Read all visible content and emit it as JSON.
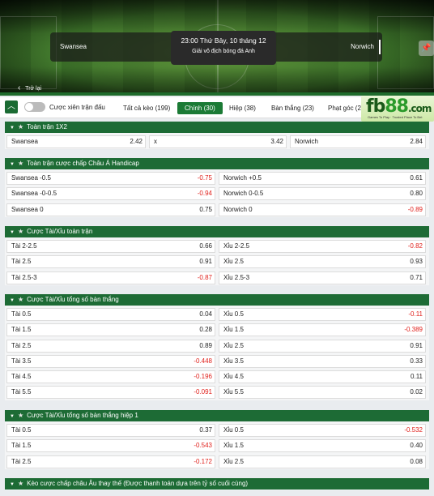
{
  "match": {
    "home": "Swansea",
    "away": "Norwich",
    "time": "23:00 Thứ Bảy, 10 tháng 12",
    "league": "Giải vô địch bóng đá Anh",
    "back_label": "Trở lại"
  },
  "logo": {
    "brand_a": "fb",
    "brand_b": "88",
    "brand_c": ".com",
    "tagline": "Games To Play · Trusted Place To Bet"
  },
  "toolbar": {
    "parlay_label": "Cược xiên trận đấu",
    "tabs": [
      {
        "label": "Tất cả kèo (199)"
      },
      {
        "label": "Chính (30)"
      },
      {
        "label": "Hiệp (38)"
      },
      {
        "label": "Bàn thắng (23)"
      },
      {
        "label": "Phạt góc (24"
      }
    ]
  },
  "sections": [
    {
      "title": "Toàn trận 1X2",
      "rows": [
        {
          "a_label": "Swansea",
          "a_odd": "2.42",
          "b_label": "x",
          "b_odd": "3.42",
          "c_label": "Norwich",
          "c_odd": "2.84"
        }
      ]
    },
    {
      "title": "Toàn trận cược chấp Châu Á Handicap",
      "rows": [
        {
          "l_label": "Swansea -0.5",
          "l_odd": "-0.75",
          "r_label": "Norwich +0.5",
          "r_odd": "0.61"
        },
        {
          "l_label": "Swansea -0-0.5",
          "l_odd": "-0.94",
          "r_label": "Norwich 0-0.5",
          "r_odd": "0.80"
        },
        {
          "l_label": "Swansea 0",
          "l_odd": "0.75",
          "r_label": "Norwich 0",
          "r_odd": "-0.89"
        }
      ]
    },
    {
      "title": "Cược Tài/Xỉu toàn trận",
      "rows": [
        {
          "l_label": "Tài 2-2.5",
          "l_odd": "0.66",
          "r_label": "Xỉu 2-2.5",
          "r_odd": "-0.82"
        },
        {
          "l_label": "Tài 2.5",
          "l_odd": "0.91",
          "r_label": "Xỉu 2.5",
          "r_odd": "0.93"
        },
        {
          "l_label": "Tài 2.5-3",
          "l_odd": "-0.87",
          "r_label": "Xỉu 2.5-3",
          "r_odd": "0.71"
        }
      ]
    },
    {
      "title": "Cược Tài/Xỉu tổng số bàn thắng",
      "rows": [
        {
          "l_label": "Tài 0.5",
          "l_odd": "0.04",
          "r_label": "Xỉu 0.5",
          "r_odd": "-0.11"
        },
        {
          "l_label": "Tài 1.5",
          "l_odd": "0.28",
          "r_label": "Xỉu 1.5",
          "r_odd": "-0.389"
        },
        {
          "l_label": "Tài 2.5",
          "l_odd": "0.89",
          "r_label": "Xỉu 2.5",
          "r_odd": "0.91"
        },
        {
          "l_label": "Tài 3.5",
          "l_odd": "-0.448",
          "r_label": "Xỉu 3.5",
          "r_odd": "0.33"
        },
        {
          "l_label": "Tài 4.5",
          "l_odd": "-0.196",
          "r_label": "Xỉu 4.5",
          "r_odd": "0.11"
        },
        {
          "l_label": "Tài 5.5",
          "l_odd": "-0.091",
          "r_label": "Xỉu 5.5",
          "r_odd": "0.02"
        }
      ]
    },
    {
      "title": "Cược Tài/Xỉu tổng số bàn thắng hiệp 1",
      "rows": [
        {
          "l_label": "Tài 0.5",
          "l_odd": "0.37",
          "r_label": "Xỉu 0.5",
          "r_odd": "-0.532"
        },
        {
          "l_label": "Tài 1.5",
          "l_odd": "-0.543",
          "r_label": "Xỉu 1.5",
          "r_odd": "0.40"
        },
        {
          "l_label": "Tài 2.5",
          "l_odd": "-0.172",
          "r_label": "Xỉu 2.5",
          "r_odd": "0.08"
        }
      ]
    },
    {
      "title": "Kèo cược chấp châu Âu thay thế (Được thanh toán dựa trên tỷ số cuối cùng)",
      "rows": []
    }
  ],
  "colors": {
    "header_green": "#1d6b35",
    "negative_red": "#e0201b"
  }
}
